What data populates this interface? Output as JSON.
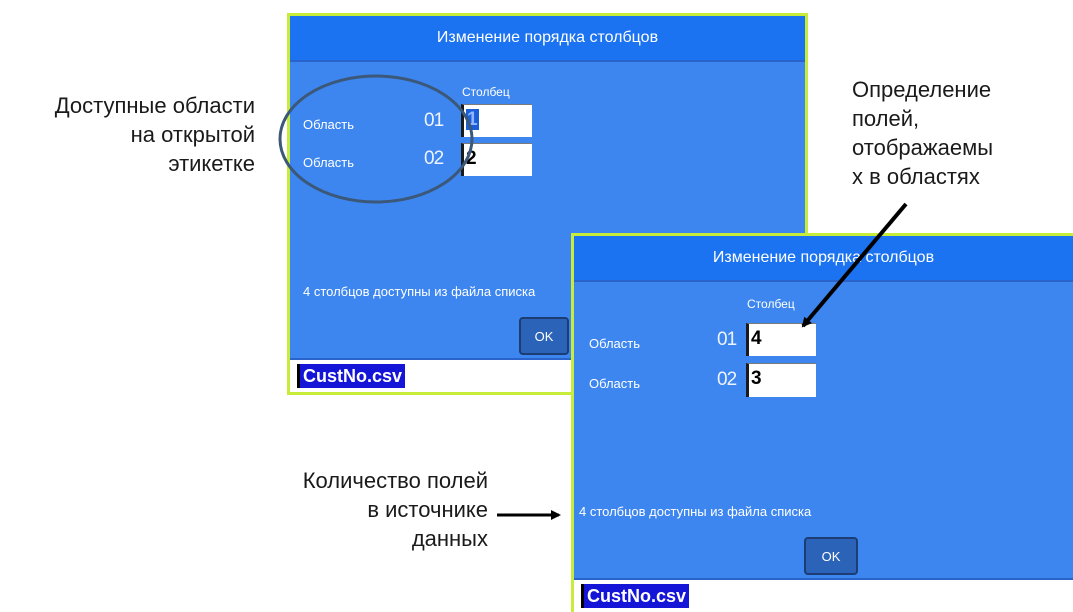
{
  "dialog_top": {
    "title": "Изменение порядка столбцов",
    "column_header": "Столбец",
    "rows": [
      {
        "label": "Область",
        "number": "01",
        "value": "1"
      },
      {
        "label": "Область",
        "number": "02",
        "value": "2"
      }
    ],
    "info": "4 столбцов доступны из файла списка",
    "ok_label": "OK",
    "filename": "CustNo.csv"
  },
  "dialog_bottom": {
    "title": "Изменение порядка столбцов",
    "column_header": "Столбец",
    "rows": [
      {
        "label": "Область",
        "number": "01",
        "value": "4"
      },
      {
        "label": "Область",
        "number": "02",
        "value": "3"
      }
    ],
    "info": "4 столбцов доступны из файла списка",
    "ok_label": "OK",
    "filename": "CustNo.csv"
  },
  "callouts": {
    "areas": [
      "Доступные области",
      "на открытой",
      "этикетке"
    ],
    "fields": [
      "Определение",
      "полей,",
      "отображаемы",
      "х в областях"
    ],
    "count": [
      "Количество полей",
      "в источнике",
      "данных"
    ]
  },
  "colors": {
    "dialog_bg": "#3d86f0",
    "titlebar_bg": "#1b73f2",
    "dialog_border": "#c8ec3a",
    "selection": "#1515d8",
    "ellipse": "#3c5878"
  }
}
